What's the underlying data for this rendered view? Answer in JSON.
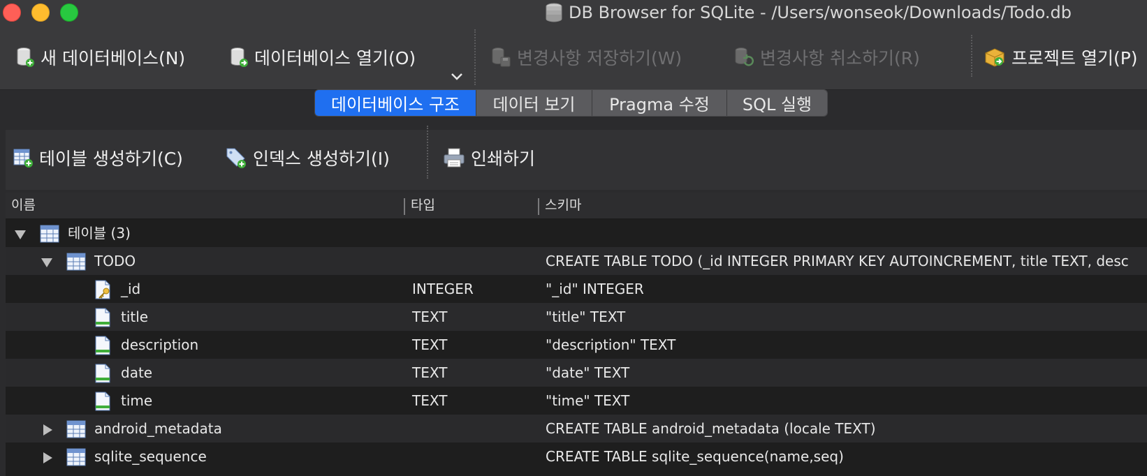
{
  "window": {
    "title": "DB Browser for SQLite - /Users/wonseok/Downloads/Todo.db",
    "app_icon": "database-stack-icon"
  },
  "toolbar": {
    "new_db": "새 데이터베이스(N)",
    "open_db": "데이터베이스 열기(O)",
    "save_changes": "변경사항 저장하기(W)",
    "revert_changes": "변경사항 취소하기(R)",
    "open_project": "프로젝트 열기(P)"
  },
  "tabs": [
    {
      "label": "데이터베이스 구조",
      "active": true
    },
    {
      "label": "데이터 보기",
      "active": false
    },
    {
      "label": "Pragma 수정",
      "active": false
    },
    {
      "label": "SQL 실행",
      "active": false
    }
  ],
  "structure_toolbar": {
    "create_table": "테이블 생성하기(C)",
    "create_index": "인덱스 생성하기(I)",
    "print": "인쇄하기"
  },
  "tree": {
    "columns": [
      "이름",
      "타입",
      "스키마"
    ],
    "rows": [
      {
        "name": "테이블 (3)",
        "type": "",
        "schema": "",
        "level": 0,
        "kind": "group",
        "expanded": true
      },
      {
        "name": "TODO",
        "type": "",
        "schema": "CREATE TABLE TODO (_id INTEGER PRIMARY KEY AUTOINCREMENT, title TEXT, desc",
        "level": 1,
        "kind": "table",
        "expanded": true
      },
      {
        "name": "_id",
        "type": "INTEGER",
        "schema": "\"_id\" INTEGER",
        "level": 2,
        "kind": "key-field"
      },
      {
        "name": "title",
        "type": "TEXT",
        "schema": "\"title\" TEXT",
        "level": 2,
        "kind": "field"
      },
      {
        "name": "description",
        "type": "TEXT",
        "schema": "\"description\" TEXT",
        "level": 2,
        "kind": "field"
      },
      {
        "name": "date",
        "type": "TEXT",
        "schema": "\"date\" TEXT",
        "level": 2,
        "kind": "field"
      },
      {
        "name": "time",
        "type": "TEXT",
        "schema": "\"time\" TEXT",
        "level": 2,
        "kind": "field"
      },
      {
        "name": "android_metadata",
        "type": "",
        "schema": "CREATE TABLE android_metadata (locale TEXT)",
        "level": 1,
        "kind": "table",
        "expanded": false
      },
      {
        "name": "sqlite_sequence",
        "type": "",
        "schema": "CREATE TABLE sqlite_sequence(name,seq)",
        "level": 1,
        "kind": "table",
        "expanded": false
      }
    ]
  },
  "colors": {
    "accent": "#1f6ff0",
    "window_bg": "#3a3a3c",
    "tree_bg": "#1e1e1e"
  }
}
